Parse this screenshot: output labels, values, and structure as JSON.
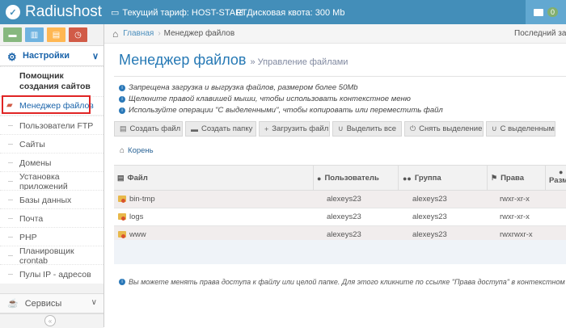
{
  "header": {
    "app_name": "Radiushost",
    "tariff": "Текущий тариф: HOST-START",
    "quota": "Дисковая квота: 300 Mb",
    "mail_count": "0",
    "brand_color": "#438eb9"
  },
  "sidebar": {
    "shortcut_colors": [
      "#87b87f",
      "#6fb3e0",
      "#ffb752",
      "#d15b47"
    ],
    "section_label": "Настройки",
    "items": [
      {
        "label": "Помощник создания сайтов",
        "active": false
      },
      {
        "label": "Менеджер файлов",
        "active": true
      },
      {
        "label": "Пользователи FTP",
        "active": false
      },
      {
        "label": "Сайты",
        "active": false
      },
      {
        "label": "Домены",
        "active": false
      },
      {
        "label": "Установка приложений",
        "active": false
      },
      {
        "label": "Базы данных",
        "active": false
      },
      {
        "label": "Почта",
        "active": false
      },
      {
        "label": "PHP",
        "active": false
      },
      {
        "label": "Планировщик crontab",
        "active": false
      },
      {
        "label": "Пулы IP - адресов",
        "active": false
      }
    ],
    "services_label": "Сервисы"
  },
  "breadcrumbs": {
    "home": "Главная",
    "current": "Менеджер файлов",
    "right_text": "Последний зах"
  },
  "page": {
    "title": "Менеджер файлов",
    "subtitle": "» Управление файлами",
    "notes": [
      "Запрещена загрузка и выгрузка файлов, размером более 50Mb",
      "Щелкните правой клавишей мыши, чтобы использовать контекстное меню",
      "Используйте операции \"С выделенными\", чтобы копировать или переместить файл"
    ],
    "toolbar": [
      {
        "label": "Создать файл",
        "icon": "file-icon"
      },
      {
        "label": "Создать папку",
        "icon": "folder-icon"
      },
      {
        "label": "Загрузить файл",
        "icon": "plus-icon"
      },
      {
        "label": "Выделить все",
        "icon": "magnet-icon"
      },
      {
        "label": "Снять выделение",
        "icon": "power-icon"
      },
      {
        "label": "С выделенными",
        "icon": "magnet-icon"
      }
    ],
    "root_label": "Корень",
    "table": {
      "headers": [
        "Файл",
        "Пользователь",
        "Группа",
        "Права",
        "Разм"
      ],
      "rows": [
        {
          "name": "bin-tmp",
          "user": "alexeys23",
          "group": "alexeys23",
          "perms": "rwxr-xr-x"
        },
        {
          "name": "logs",
          "user": "alexeys23",
          "group": "alexeys23",
          "perms": "rwxr-xr-x"
        },
        {
          "name": "www",
          "user": "alexeys23",
          "group": "alexeys23",
          "perms": "rwxrwxr-x"
        }
      ]
    },
    "bottom_note": "Вы можете менять права доступа к файлу или целой папке. Для этого кликните по ссылке \"Права доступа\" в контекстном ме"
  }
}
